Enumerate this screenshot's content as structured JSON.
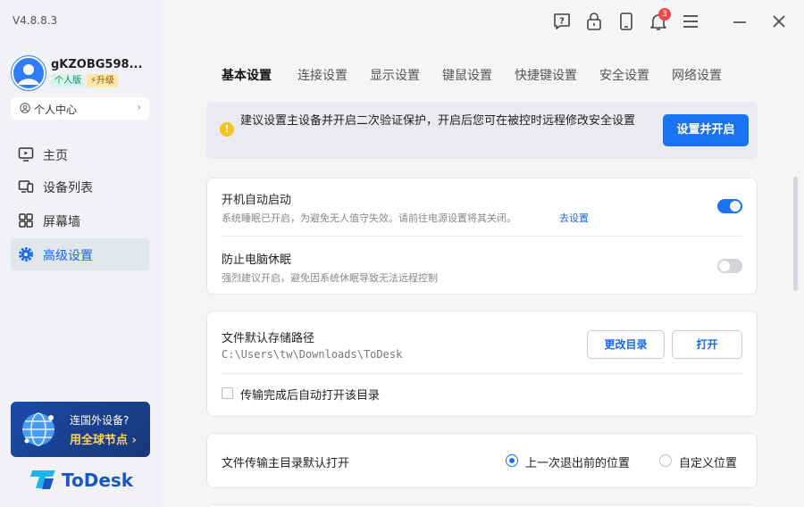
{
  "app": {
    "version": "V4.8.8.3",
    "brand_color": "#1a73f0"
  },
  "sidebar": {
    "user": {
      "name": "gKZOBG598...",
      "badge_personal": "个人版",
      "badge_upgrade": "升级"
    },
    "personal_center": "个人中心",
    "items": [
      {
        "label": "主页",
        "icon": "monitor-icon"
      },
      {
        "label": "设备列表",
        "icon": "devices-icon"
      },
      {
        "label": "屏幕墙",
        "icon": "grid-icon"
      },
      {
        "label": "高级设置",
        "icon": "gear-icon",
        "active": true
      }
    ],
    "promo": {
      "line1": "连国外设备?",
      "line2": "用全球节点"
    },
    "logo_text": "ToDesk"
  },
  "topbar": {
    "icons": [
      "help-icon",
      "lock-icon",
      "phone-icon",
      "bell-icon",
      "menu-icon",
      "minimize-icon",
      "close-icon"
    ],
    "notification_count": "3"
  },
  "tabs": [
    {
      "label": "基本设置",
      "active": true
    },
    {
      "label": "连接设置"
    },
    {
      "label": "显示设置"
    },
    {
      "label": "键鼠设置"
    },
    {
      "label": "快捷键设置"
    },
    {
      "label": "安全设置"
    },
    {
      "label": "网络设置"
    }
  ],
  "notice": {
    "text": "建议设置主设备并开启二次验证保护，开启后您可在被控时远程修改安全设置",
    "button": "设置并开启"
  },
  "startup_card": {
    "auto_start": {
      "title": "开机自动启动",
      "desc": "系统睡眠已开启，为避免无人值守失效。请前往电源设置将其关闭。",
      "link": "去设置",
      "enabled": true
    },
    "prevent_sleep": {
      "title": "防止电脑休眠",
      "desc": "强烈建议开启，避免因系统休眠导致无法远程控制",
      "enabled": false
    }
  },
  "storage_card": {
    "title": "文件默认存储路径",
    "path": "C:\\Users\\tw\\Downloads\\ToDesk",
    "change_button": "更改目录",
    "open_button": "打开",
    "checkbox_label": "传输完成后自动打开该目录",
    "checkbox_checked": false
  },
  "transfer_card": {
    "title": "文件传输主目录默认打开",
    "options": [
      "上一次退出前的位置",
      "自定义位置"
    ],
    "selected": "上一次退出前的位置"
  }
}
